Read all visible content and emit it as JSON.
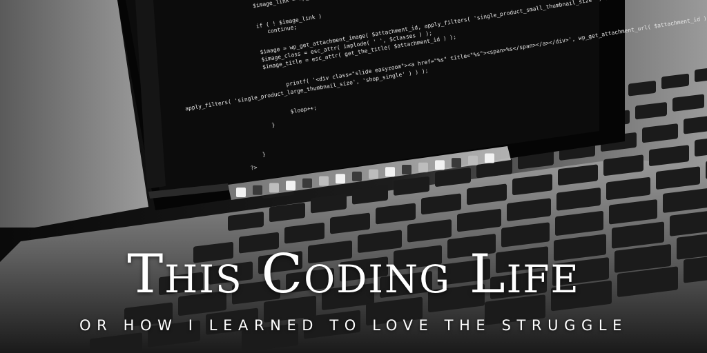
{
  "overlay": {
    "title": "This Coding Life",
    "subtitle": "or how I learned to love the struggle"
  },
  "screen_code": [
    "$image_link = wp_get_attachment_url( $attachment_id );",
    "if ( ! $image_link )",
    "continue;",
    "$image       = wp_get_attachment_image( $attachment_id, apply_filters( 'single_product_small_thumbnail_size' ) );",
    "$image_class = esc_attr( implode( ' ', $classes ) );",
    "$image_title = esc_attr( get_the_title( $attachment_id ) );",
    "printf( '<div class=\"slide easyzoom\"><a href=\"%s\" title=\"%s\"><span>%s</span></a></div>', wp_get_attachment_url( $attachment_id ) );",
    "apply_filters( 'single_product_large_thumbnail_size', 'shop_single' ) ) );",
    "$loop++;",
    "}",
    "}",
    "?>"
  ],
  "colors": {
    "background": "#111111",
    "screen": "#0c0c0c",
    "code_text": "#e6e6e6",
    "title_text": "#ffffff"
  }
}
